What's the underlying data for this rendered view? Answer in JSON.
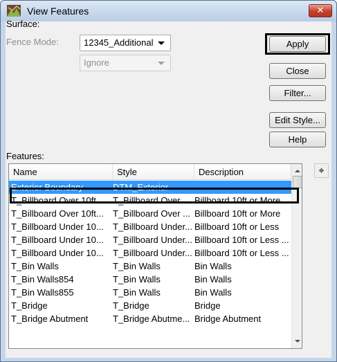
{
  "window": {
    "title": "View Features",
    "close_glyph": "✕"
  },
  "surface": {
    "label": "Surface:",
    "value": "12345_Additional"
  },
  "fence_mode": {
    "label": "Fence Mode:",
    "value": "Ignore"
  },
  "buttons": {
    "apply": "Apply",
    "close": "Close",
    "filter": "Filter...",
    "edit_style": "Edit Style...",
    "help": "Help"
  },
  "features": {
    "label": "Features:",
    "columns": [
      "Name",
      "Style",
      "Description"
    ],
    "rows": [
      {
        "name": "Exterior Boundary",
        "style": "DTM_Exterior",
        "description": "",
        "selected": true
      },
      {
        "name": "T_Billboard Over 10ft",
        "style": "T_Billboard Over ...",
        "description": "Billboard 10ft or More"
      },
      {
        "name": "T_Billboard Over 10ft...",
        "style": "T_Billboard Over ...",
        "description": "Billboard 10ft or More"
      },
      {
        "name": "T_Billboard Under 10...",
        "style": "T_Billboard Under...",
        "description": "Billboard 10ft or Less"
      },
      {
        "name": "T_Billboard Under 10...",
        "style": "T_Billboard Under...",
        "description": "Billboard 10ft or Less ..."
      },
      {
        "name": "T_Billboard Under 10...",
        "style": "T_Billboard Under...",
        "description": "Billboard 10ft or Less ..."
      },
      {
        "name": "T_Bin Walls",
        "style": "T_Bin Walls",
        "description": "Bin Walls"
      },
      {
        "name": "T_Bin Walls854",
        "style": "T_Bin Walls",
        "description": "Bin Walls"
      },
      {
        "name": "T_Bin Walls855",
        "style": "T_Bin Walls",
        "description": "Bin Walls"
      },
      {
        "name": "T_Bridge",
        "style": "T_Bridge",
        "description": "Bridge"
      },
      {
        "name": "T_Bridge Abutment",
        "style": "T_Bridge Abutme...",
        "description": "Bridge Abutment"
      }
    ]
  },
  "locate_button": {
    "glyph": "⌖"
  },
  "colors": {
    "selection": "#3399ff",
    "window_frame": "#c5d6ea",
    "close_button": "#c4402b"
  }
}
